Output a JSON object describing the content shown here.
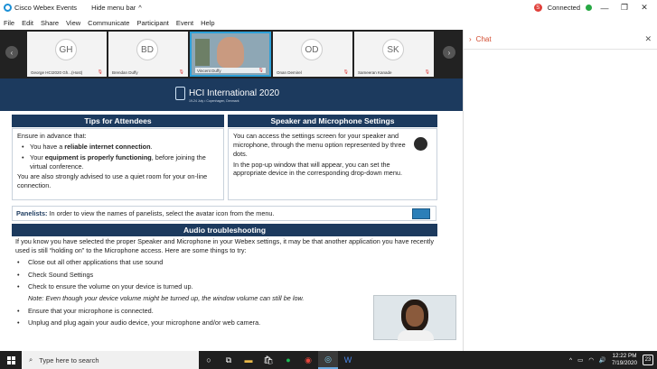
{
  "window": {
    "title": "Cisco Webex Events",
    "hide_menu_label": "Hide menu bar",
    "status_badge": "S",
    "status_text": "Connected"
  },
  "menu": [
    "File",
    "Edit",
    "Share",
    "View",
    "Communicate",
    "Participant",
    "Event",
    "Help"
  ],
  "participants": [
    {
      "initials": "GH",
      "name": "George HCI2020 Gh...(Host)"
    },
    {
      "initials": "BD",
      "name": "Brendan Duffy"
    },
    {
      "initials": "",
      "name": "Vincent Duffy"
    },
    {
      "initials": "OD",
      "name": "Onan Demirel"
    },
    {
      "initials": "SK",
      "name": "Sameeran Kanade"
    }
  ],
  "chat": {
    "title": "Chat"
  },
  "slide": {
    "logo_text": "HCI International 2020",
    "logo_sub": "19-24 July • Copenhagen, Denmark",
    "tips": {
      "header": "Tips for Attendees",
      "intro": "Ensure in advance that:",
      "b1_pre": "You have a ",
      "b1_bold": "reliable internet connection",
      "b1_post": ".",
      "b2_pre": "Your ",
      "b2_bold": "equipment is properly functioning",
      "b2_post": ", before joining the virtual conference.",
      "outro": "You are also strongly advised to use a quiet room for your on-line connection."
    },
    "speaker": {
      "header": "Speaker and Microphone Settings",
      "p1": "You can access the settings screen for your speaker and microphone, through the menu option represented by three dots.",
      "p2": "In the pop-up window that will appear, you can set the appropriate device in the corresponding drop-down menu."
    },
    "panelists": {
      "label": "Panelists:",
      "text": "In order to view the names of panelists, select the avatar icon from the menu."
    },
    "audio": {
      "header": "Audio troubleshooting",
      "intro": "If you know you have selected the proper Speaker and Microphone in your Webex settings, it may be that another application you have recently used is still “holding on” to the Microphone access. Here are some things to try:",
      "items": [
        "Close out all other applications that use sound",
        "Check Sound Settings",
        "Check to ensure the volume on your device is turned up."
      ],
      "note": "Note: Even though your device volume might be turned up, the window volume can still be low.",
      "items2": [
        "Ensure that your microphone is connected.",
        "Unplug and plug again your audio device, your microphone and/or web camera."
      ]
    }
  },
  "taskbar": {
    "search_placeholder": "Type here to search",
    "time": "12:22 PM",
    "date": "7/19/2020",
    "notifications": "23"
  }
}
